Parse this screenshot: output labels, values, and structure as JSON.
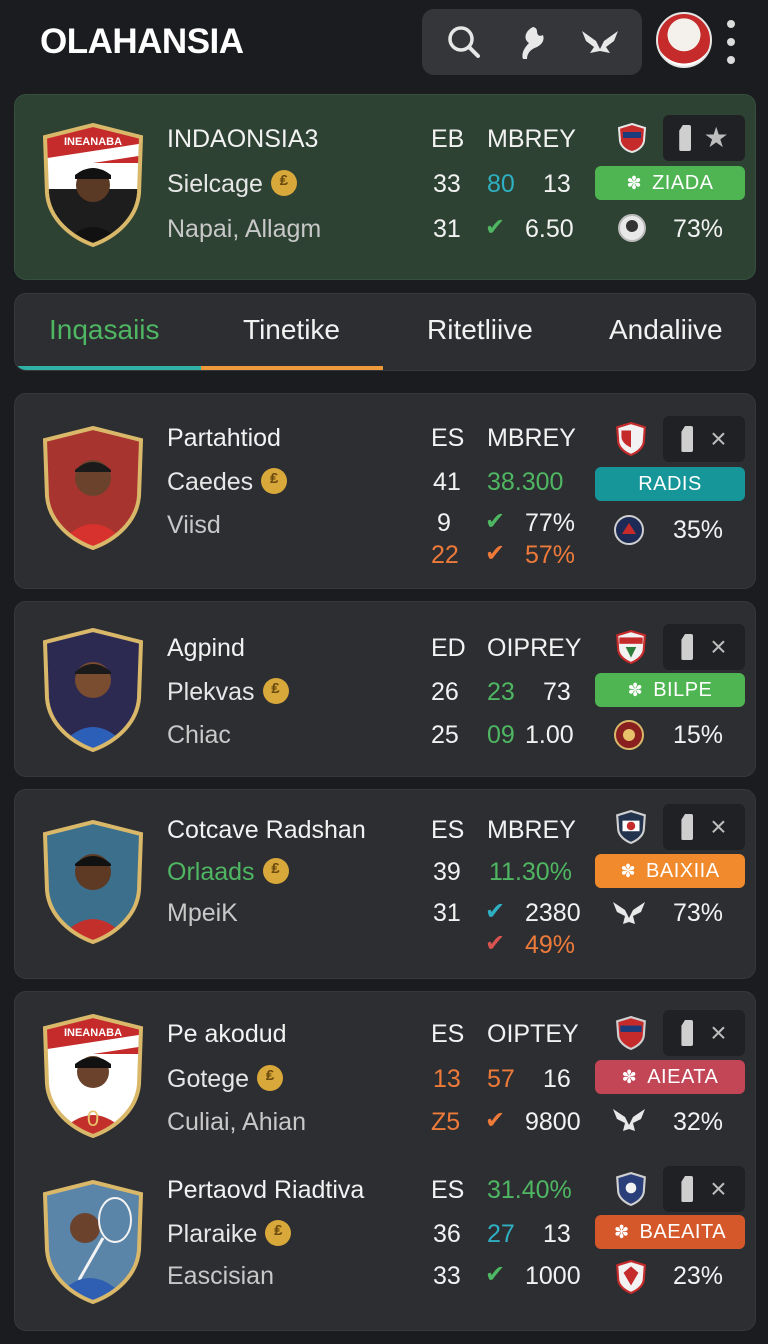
{
  "header": {
    "title": "OLAHANSIA",
    "icons": [
      "search-icon",
      "leaf-icon",
      "wings-icon"
    ]
  },
  "featured": {
    "name": "INDAONSIA3",
    "team": "Sielcage",
    "location": "Napai, Allagm",
    "col1_header": "EB",
    "col2_header": "MBREY",
    "row1_a": "33",
    "row1_b": "80",
    "row1_c": "13",
    "row2_a": "31",
    "row2_c": "6.50",
    "pill": "ZIADA",
    "pct": "73%",
    "crest_text": "INEANABA"
  },
  "tabs": [
    {
      "label": "Inqasaiis"
    },
    {
      "label": "Tinetike"
    },
    {
      "label": "Ritetliive"
    },
    {
      "label": "Andaliive"
    }
  ],
  "cards": [
    {
      "name": "Partahtiod",
      "team": "Caedes",
      "sub": "Viisd",
      "col1_header": "ES",
      "col2_header": "MBREY",
      "r1a": "41",
      "r1b": "38.300",
      "r2a": "9",
      "r2c": "77%",
      "r3a": "22",
      "r3c": "57%",
      "pill": "RADIS",
      "pct": "35%"
    },
    {
      "name": "Agpind",
      "team": "Plekvas",
      "sub": "Chiac",
      "col1_header": "ED",
      "col2_header": "OIPREY",
      "r1a": "26",
      "r1b": "23",
      "r1c": "73",
      "r2a": "25",
      "r2b": "09",
      "r2c": "1.00",
      "pill": "BILPE",
      "pct": "15%"
    },
    {
      "name": "Cotcave Radshan",
      "team": "Orlaads",
      "sub": "MpeiK",
      "col1_header": "ES",
      "col2_header": "MBREY",
      "r1a": "39",
      "r1b": "11.30%",
      "r2a": "31",
      "r2c": "2380",
      "r3c": "49%",
      "pill": "BAIXIIA",
      "pct": "73%"
    },
    {
      "name": "Pe akodud",
      "team": "Gotege",
      "sub": "Culiai, Ahian",
      "col1_header": "ES",
      "col2_header": "OIPTEY",
      "r1a": "13",
      "r1b": "57",
      "r1c": "16",
      "r2a": "Z5",
      "r2c": "9800",
      "pill": "AIEATA",
      "pct": "32%",
      "crest_text": "INEANABA"
    },
    {
      "name": "Pertaovd Riadtiva",
      "team": "Plaraike",
      "sub": "Eascisian",
      "col1_header": "ES",
      "col2_header": "31.40%",
      "r1a": "36",
      "r1b": "27",
      "r1c": "13",
      "r2a": "33",
      "r2c": "1000",
      "pill": "BAEAITA",
      "pct": "23%"
    }
  ],
  "colors": {
    "featured_bg": "#2d4233",
    "green": "#4fb662",
    "teal": "#2fb0c2",
    "orange": "#ee7a3a",
    "pill_green": "#4fb552",
    "pill_teal": "#17969a",
    "pill_orange": "#f08a2c",
    "pill_red": "#c24656",
    "pill_darkorange": "#d5582a"
  }
}
